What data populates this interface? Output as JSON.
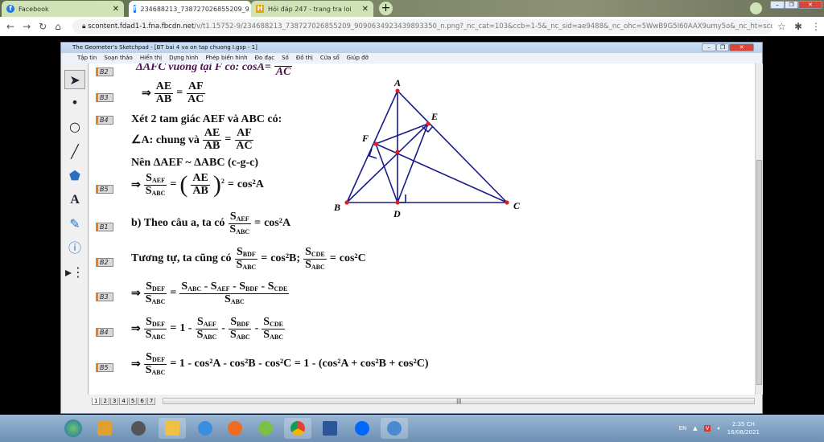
{
  "browser": {
    "tabs": [
      {
        "label": "Facebook",
        "icon": "facebook-icon"
      },
      {
        "label": "234688213_738727026855209_9",
        "icon": "facebook-square-icon"
      },
      {
        "label": "Hỏi đáp 247 - trang tra loi",
        "icon": "hoidap-icon"
      }
    ],
    "url_host": "scontent.fdad1-1.fna.fbcdn.net",
    "url_rest": "/v/t1.15752-9/234688213_738727026855209_9090634923439893350_n.png?_nc_cat=103&ccb=1-5&_nc_sid=ae9488&_nc_ohc=5WwB9G5I60AAX9umy5o&_nc_ht=scontent.fd..."
  },
  "app": {
    "title": "The Geometer's Sketchpad - [BT bai 4 va on tap chuong I.gsp - 1]",
    "menu": [
      "Tập tin",
      "Soạn thảo",
      "Hiển thị",
      "Dựng hình",
      "Phép biến hình",
      "Đo đạc",
      "Số",
      "Đồ thị",
      "Cửa sổ",
      "Giúp đỡ"
    ],
    "pages": [
      "1",
      "2",
      "3",
      "4",
      "5",
      "6",
      "7"
    ]
  },
  "buttons": [
    "B2",
    "B3",
    "B4",
    "B5",
    "B1",
    "B2",
    "B3",
    "B4",
    "B5"
  ],
  "math": {
    "b2_text": "ΔAFC vuông tại F có: cosA=",
    "b2_den": "AC",
    "imp": "⇒",
    "eq": "=",
    "AE": "AE",
    "AB": "AB",
    "AF": "AF",
    "AC": "AC",
    "b4_l1": "Xét 2 tam giác AEF và ABC có:",
    "b4_l2": "∠A: chung và",
    "b4_l3": "Nên  ΔAEF ~ ΔABC (c-g-c)",
    "S": "S",
    "AEF": "AEF",
    "ABC": "ABC",
    "BDF": "BDF",
    "CDE": "CDE",
    "DEF": "DEF",
    "sq": "2",
    "cos2A": "cos²A",
    "cos2B": "cos²B",
    "cos2C": "cos²C",
    "b1_text": "b) Theo câu a, ta có",
    "b2b_text": "Tương tự, ta cũng có",
    "semicolon": ";",
    "minus": "-",
    "one_minus": "1 -",
    "b5_tail": "= 1 - cos²A - cos²B - cos²C = 1 - (cos²A + cos²B + cos²C)"
  },
  "figure": {
    "points": [
      "A",
      "B",
      "C",
      "D",
      "E",
      "F"
    ],
    "line_color": "#1a1a8c",
    "point_color": "#e02020"
  },
  "taskbar": {
    "lang": "EN",
    "time": "2:35 CH",
    "date": "16/08/2021"
  }
}
